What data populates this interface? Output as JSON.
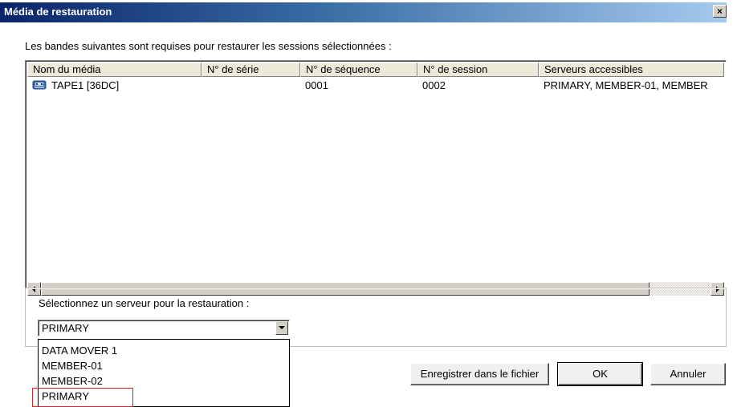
{
  "window": {
    "title": "Média de restauration",
    "close_glyph": "×"
  },
  "instruction": "Les bandes suivantes sont requises pour restaurer les sessions sélectionnées :",
  "list": {
    "columns": [
      "Nom du média",
      "N° de série",
      "N° de séquence",
      "N° de session",
      "Serveurs accessibles"
    ],
    "rows": [
      {
        "icon": "tape-icon",
        "media_name": "TAPE1 [36DC]",
        "serial": "",
        "sequence": "0001",
        "session": "0002",
        "servers": "PRIMARY, MEMBER-01, MEMBER"
      }
    ]
  },
  "server_group": {
    "label": "Sélectionnez un serveur pour la restauration :",
    "selected": "PRIMARY",
    "options": [
      "DATA MOVER 1",
      "MEMBER-01",
      "MEMBER-02",
      "PRIMARY"
    ]
  },
  "buttons": {
    "save_to_file": "Enregistrer dans le fichier",
    "ok": "OK",
    "cancel": "Annuler"
  },
  "colors": {
    "titlebar_start": "#0a246a",
    "highlight_border": "#e02020"
  }
}
